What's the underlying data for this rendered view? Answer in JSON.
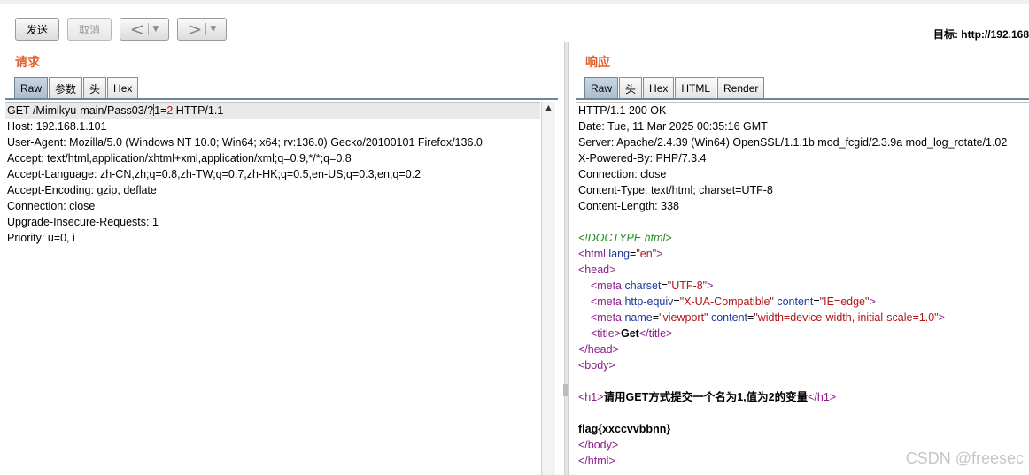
{
  "toolbar": {
    "send_label": "发送",
    "cancel_label": "取消",
    "back_arrow": "<",
    "forward_arrow": ">",
    "dropdown_caret": "▼",
    "target_label": "目标: http://192.168"
  },
  "request": {
    "title": "请求",
    "tabs": [
      "Raw",
      "参数",
      "头",
      "Hex"
    ],
    "active_tab": "Raw",
    "first_line": {
      "before_caret": "GET /Mimikyu-main/Pass03/?",
      "param_name": "1",
      "eq": "=",
      "param_value": "2",
      "after": " HTTP/1.1"
    },
    "lines": [
      "Host: 192.168.1.101",
      "User-Agent: Mozilla/5.0 (Windows NT 10.0; Win64; x64; rv:136.0) Gecko/20100101 Firefox/136.0",
      "Accept: text/html,application/xhtml+xml,application/xml;q=0.9,*/*;q=0.8",
      "Accept-Language: zh-CN,zh;q=0.8,zh-TW;q=0.7,zh-HK;q=0.5,en-US;q=0.3,en;q=0.2",
      "Accept-Encoding: gzip, deflate",
      "Connection: close",
      "Upgrade-Insecure-Requests: 1",
      "Priority: u=0, i"
    ]
  },
  "response": {
    "title": "响应",
    "tabs": [
      "Raw",
      "头",
      "Hex",
      "HTML",
      "Render"
    ],
    "active_tab": "Raw",
    "headers": [
      "HTTP/1.1 200 OK",
      "Date: Tue, 11 Mar 2025 00:35:16 GMT",
      "Server: Apache/2.4.39 (Win64) OpenSSL/1.1.1b mod_fcgid/2.3.9a mod_log_rotate/1.02",
      "X-Powered-By: PHP/7.3.4",
      "Connection: close",
      "Content-Type: text/html; charset=UTF-8",
      "Content-Length: 338"
    ],
    "body": {
      "doctype": "<!DOCTYPE html>",
      "html_open_tag": "<html",
      "html_lang_attr": "lang",
      "html_lang_val": "\"en\"",
      "head_open": "<head>",
      "meta1_tag": "<meta",
      "meta1_attr": "charset",
      "meta1_val": "\"UTF-8\"",
      "meta2_tag": "<meta",
      "meta2_attr1": "http-equiv",
      "meta2_val1": "\"X-UA-Compatible\"",
      "meta2_attr2": "content",
      "meta2_val2": "\"IE=edge\"",
      "meta3_tag": "<meta",
      "meta3_attr1": "name",
      "meta3_val1": "\"viewport\"",
      "meta3_attr2": "content",
      "meta3_val2": "\"width=device-width, initial-scale=1.0\"",
      "title_open": "<title>",
      "title_text": "Get",
      "title_close": "</title>",
      "head_close": "</head>",
      "body_open": "<body>",
      "h1_open": "<h1>",
      "h1_text": "请用GET方式提交一个名为1,值为2的变量",
      "h1_close": "</h1>",
      "flag": "flag{xxccvvbbnn}",
      "body_close": "</body>",
      "html_close": "</html>"
    }
  },
  "watermark": "CSDN @freesec"
}
